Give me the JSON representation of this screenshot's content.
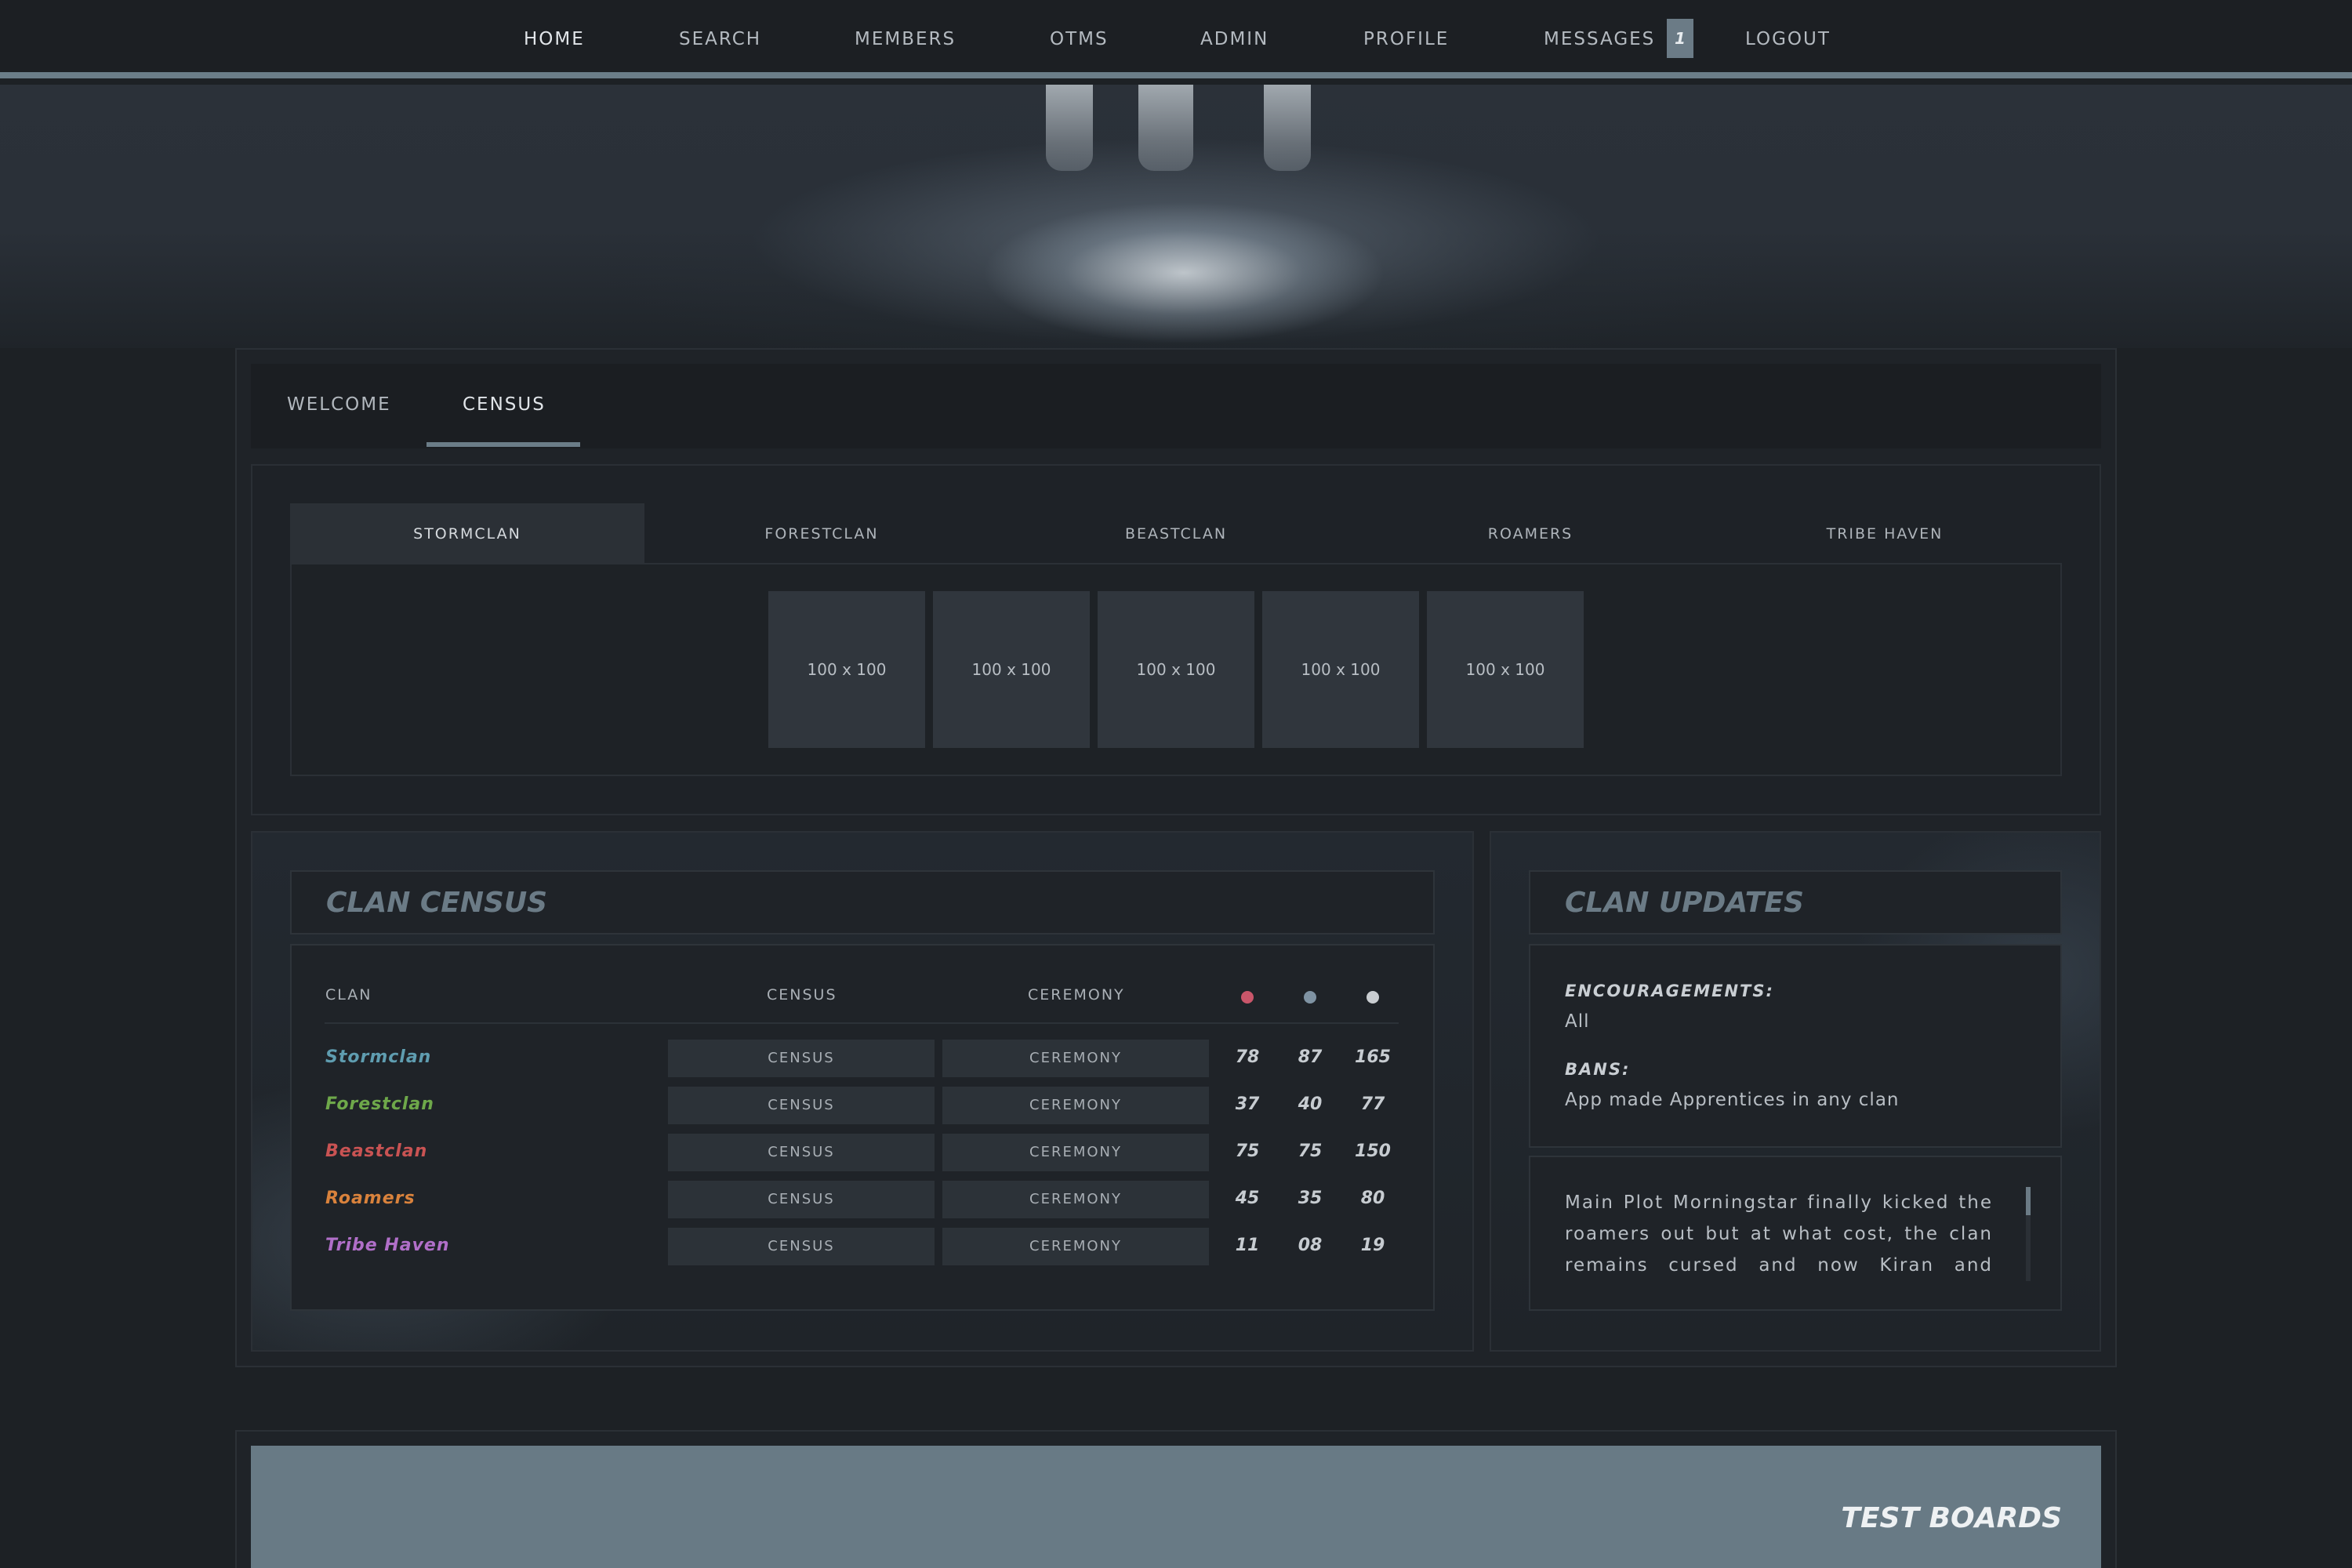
{
  "nav": {
    "items": [
      {
        "label": "HOME"
      },
      {
        "label": "SEARCH"
      },
      {
        "label": "MEMBERS"
      },
      {
        "label": "OTMS"
      },
      {
        "label": "ADMIN"
      },
      {
        "label": "PROFILE"
      },
      {
        "label": "MESSAGES"
      },
      {
        "label": "LOGOUT"
      }
    ],
    "message_count": "1",
    "accent_color": "#6b7d88"
  },
  "tabs": [
    {
      "label": "WELCOME"
    },
    {
      "label": "CENSUS",
      "active": true
    }
  ],
  "clan_tabs": [
    {
      "label": "STORMCLAN",
      "active": true
    },
    {
      "label": "FORESTCLAN"
    },
    {
      "label": "BEASTCLAN"
    },
    {
      "label": "ROAMERS"
    },
    {
      "label": "TRIBE HAVEN"
    }
  ],
  "gallery": {
    "thumbs": [
      "100 x 100",
      "100 x 100",
      "100 x 100",
      "100 x 100",
      "100 x 100"
    ]
  },
  "census": {
    "title": "CLAN CENSUS",
    "headers": {
      "clan": "CLAN",
      "census": "CENSUS",
      "ceremony": "CEREMONY"
    },
    "dot_colors": [
      "#c9566a",
      "#7f93a3",
      "#c9cdd1"
    ],
    "rows": [
      {
        "name": "Stormclan",
        "color": "#5f9db0",
        "census": "CENSUS",
        "ceremony": "CEREMONY",
        "a": "78",
        "b": "87",
        "total": "165"
      },
      {
        "name": "Forestclan",
        "color": "#6ea84a",
        "census": "CENSUS",
        "ceremony": "CEREMONY",
        "a": "37",
        "b": "40",
        "total": "77"
      },
      {
        "name": "Beastclan",
        "color": "#c95353",
        "census": "CENSUS",
        "ceremony": "CEREMONY",
        "a": "75",
        "b": "75",
        "total": "150"
      },
      {
        "name": "Roamers",
        "color": "#d9823c",
        "census": "CENSUS",
        "ceremony": "CEREMONY",
        "a": "45",
        "b": "35",
        "total": "80"
      },
      {
        "name": "Tribe Haven",
        "color": "#b06fc8",
        "census": "CENSUS",
        "ceremony": "CEREMONY",
        "a": "11",
        "b": "08",
        "total": "19"
      }
    ]
  },
  "updates": {
    "title": "CLAN UPDATES",
    "encouragements_label": "ENCOURAGEMENTS:",
    "encouragements_value": "All",
    "bans_label": "BANS:",
    "bans_value": "App made Apprentices in any clan",
    "plot_text": "Main Plot Morningstar finally kicked the roamers out but at what cost, the clan remains cursed and now Kiran and Fallow"
  },
  "boards": {
    "title": "TEST BOARDS"
  }
}
